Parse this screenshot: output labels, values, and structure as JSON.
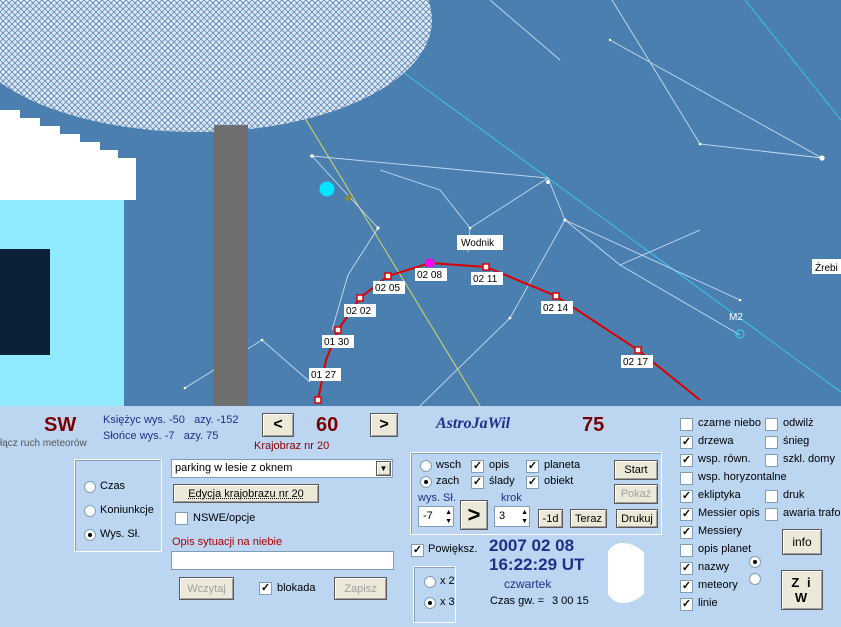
{
  "sky": {
    "constellation_label": "Wodnik",
    "edge_label": "Źrebi",
    "messier_label": "M2",
    "track_labels": [
      "01 27",
      "01 30",
      "02 02",
      "02 05",
      "02 08",
      "02 11",
      "02 14",
      "02 17"
    ]
  },
  "header": {
    "direction": "SW",
    "moon_info": "Księżyc wys. -50   azy. -152",
    "sun_info": "Słońce wys. -7   azy. 75",
    "meteor_toggle": "łącz ruch meteorów",
    "prev_symbol": "<",
    "next_symbol": ">",
    "azimuth_value": "60",
    "landscape_label": "Krajobraz nr 20",
    "app_title": "AstroJaWil",
    "right_value": "75"
  },
  "mode": {
    "options": [
      "Czas",
      "Koniunkcje",
      "Wys. Sł."
    ],
    "selected": "Wys. Sł."
  },
  "landscape": {
    "selected": "parking w lesie z oknem",
    "edit_button": "Edycja krajobrazu nr 20",
    "nswe_label": "NSWE/opcje",
    "nswe_checked": false,
    "desc_label": "Opis sytuacji na niebie",
    "desc_value": "",
    "load_button": "Wczytaj",
    "lock_label": "blokada",
    "lock_checked": true,
    "save_button": "Zapisz"
  },
  "controls": {
    "wsch": "wsch",
    "zach": "zach",
    "zach_selected": true,
    "opis": "opis",
    "opis_checked": true,
    "slady": "ślady",
    "slady_checked": true,
    "planeta": "planeta",
    "planeta_checked": true,
    "obiekt": "obiekt",
    "obiekt_checked": true,
    "sun_alt_label": "wys. Sł.",
    "sun_alt_value": "-7",
    "step_label": "krok",
    "step_value": "3",
    "go_symbol": ">",
    "minus_day": "-1d",
    "now": "Teraz",
    "print": "Drukuj",
    "start": "Start",
    "show": "Pokaż"
  },
  "datetime": {
    "zoom_label": "Powiększ.",
    "zoom_checked": true,
    "x2": "x 2",
    "x3": "x 3",
    "x3_selected": true,
    "date": "2007 02 08",
    "time": "16:22:29 UT",
    "weekday": "czwartek",
    "sidereal_label": "Czas gw. =",
    "sidereal_value": "3 00 15"
  },
  "options_col1": [
    {
      "label": "czarne niebo",
      "checked": false
    },
    {
      "label": "drzewa",
      "checked": true
    },
    {
      "label": "wsp. równ.",
      "checked": true
    },
    {
      "label": "wsp. horyzontalne",
      "checked": false
    },
    {
      "label": "ekliptyka",
      "checked": true
    },
    {
      "label": "Messier opis",
      "checked": true
    },
    {
      "label": "Messiery",
      "checked": true
    },
    {
      "label": "opis planet",
      "checked": false
    },
    {
      "label": "nazwy",
      "checked": true
    },
    {
      "label": "meteory",
      "checked": true
    },
    {
      "label": "linie",
      "checked": true
    }
  ],
  "options_col2": [
    {
      "label": "odwilż",
      "checked": false
    },
    {
      "label": "śnieg",
      "checked": false
    },
    {
      "label": "szkl. domy",
      "checked": false
    },
    {
      "label": "druk",
      "checked": false
    },
    {
      "label": "awaria trafo",
      "checked": false
    }
  ],
  "buttons": {
    "info": "info",
    "ziw": "Z i W"
  },
  "colors": {
    "sky": "#4a7fb0",
    "track": "#dd0000",
    "dark_red": "#7a0000",
    "title_blue": "#1f2f8a"
  }
}
